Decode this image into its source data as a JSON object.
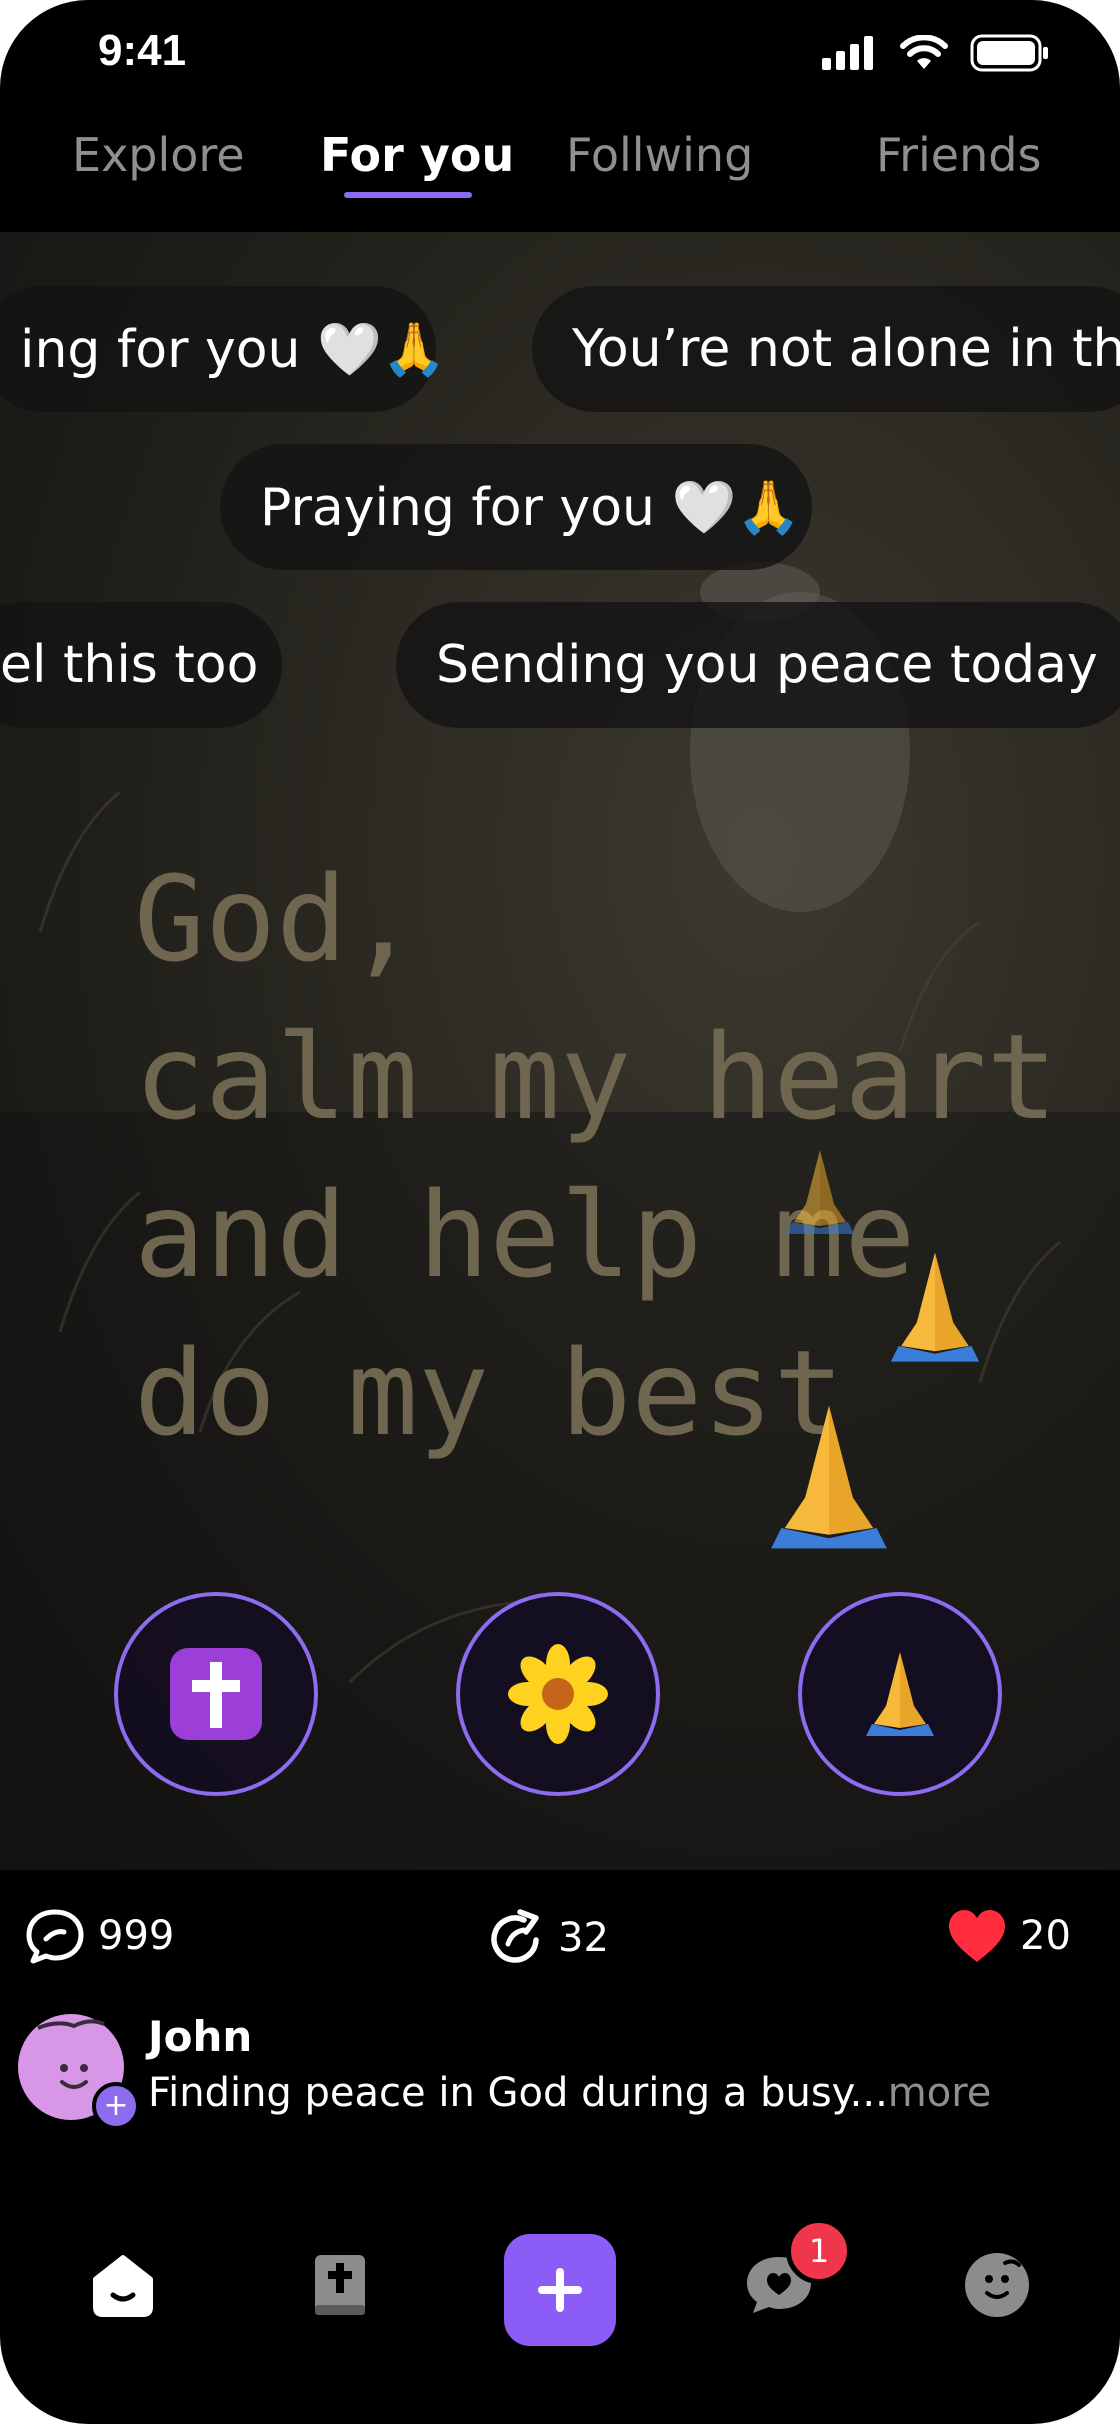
{
  "status_bar": {
    "time": "9:41"
  },
  "tabs": [
    {
      "label": "Explore",
      "active": false
    },
    {
      "label": "For you",
      "active": true
    },
    {
      "label": "Follwing",
      "active": false
    },
    {
      "label": "Friends",
      "active": false
    }
  ],
  "bubbles": [
    "ing for you 🤍🙏",
    "You’re not alone in th",
    "Praying for you 🤍🙏",
    "el this too",
    "Sending you peace today"
  ],
  "quote_lines": [
    "God,",
    "calm my heart",
    "and help me",
    "do my best"
  ],
  "reactions": [
    {
      "icon": "cross-icon"
    },
    {
      "icon": "flower-icon"
    },
    {
      "icon": "praying-hands-icon"
    }
  ],
  "stats": {
    "comments": "999",
    "shares": "32",
    "likes": "20"
  },
  "post": {
    "author": "John",
    "caption": "Finding peace in God during a busy...",
    "more_label": "more"
  },
  "nav": {
    "items": [
      "home-icon",
      "bible-icon",
      "create-icon",
      "messages-icon",
      "profile-icon"
    ],
    "messages_badge": "1"
  },
  "colors": {
    "accent": "#8B5CF6",
    "like": "#FF2D3D",
    "badge": "#F0364A"
  }
}
